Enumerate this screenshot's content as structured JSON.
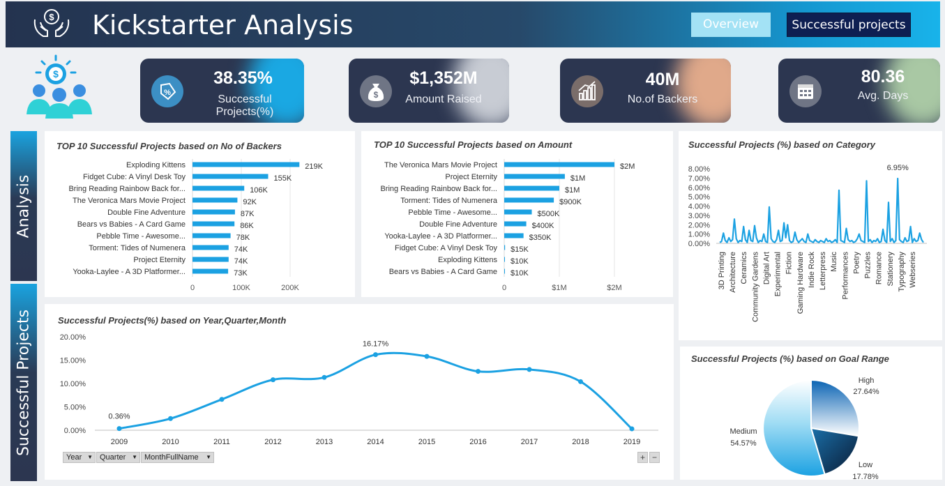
{
  "header": {
    "title": "Kickstarter Analysis",
    "nav_overview": "Overview",
    "nav_successful": "Successful projects"
  },
  "kpis": [
    {
      "value": "38.35%",
      "label": "Successful Projects(%)",
      "icon": "price-tag-percent-icon"
    },
    {
      "value": "$1,352M",
      "label": "Amount Raised",
      "icon": "money-bag-icon"
    },
    {
      "value": "40M",
      "label": "No.of Backers",
      "icon": "bar-chart-icon"
    },
    {
      "value": "80.36",
      "label": "Avg. Days",
      "icon": "calendar-icon"
    }
  ],
  "side_tabs": {
    "analysis": "Analysis",
    "successful": "Successful Projects"
  },
  "slicers": {
    "year": "Year",
    "quarter": "Quarter",
    "month": "MonthFullName",
    "plus": "+",
    "minus": "−"
  },
  "colors": {
    "accent": "#1ba1e2",
    "dark": "#2c3650",
    "header_start": "#24334f"
  },
  "chart_data": [
    {
      "id": "backers",
      "type": "bar",
      "title": "TOP 10 Successful Projects based on No of Backers",
      "categories": [
        "Exploding Kittens",
        "Fidget Cube: A Vinyl Desk Toy",
        "Bring Reading Rainbow Back for...",
        "The Veronica Mars Movie Project",
        "Double Fine Adventure",
        "Bears vs Babies - A Card Game",
        "Pebble Time - Awesome...",
        "Torment: Tides of Numenera",
        "Project Eternity",
        "Yooka-Laylee - A 3D Platformer..."
      ],
      "values": [
        219000,
        155000,
        106000,
        92000,
        87000,
        86000,
        78000,
        74000,
        74000,
        73000
      ],
      "data_labels": [
        "219K",
        "155K",
        "106K",
        "92K",
        "87K",
        "86K",
        "78K",
        "74K",
        "74K",
        "73K"
      ],
      "x_ticks": [
        "0",
        "100K",
        "200K"
      ],
      "xlim": [
        0,
        200000
      ]
    },
    {
      "id": "amount",
      "type": "bar",
      "title": "TOP 10 Successful Projects based on Amount",
      "categories": [
        "The Veronica Mars Movie Project",
        "Project Eternity",
        "Bring Reading Rainbow Back for...",
        "Torment: Tides of Numenera",
        "Pebble Time - Awesome...",
        "Double Fine Adventure",
        "Yooka-Laylee - A 3D Platformer...",
        "Fidget Cube: A Vinyl Desk Toy",
        "Exploding Kittens",
        "Bears vs Babies - A Card Game"
      ],
      "values": [
        2000000,
        1100000,
        1000000,
        900000,
        500000,
        400000,
        350000,
        15000,
        10000,
        10000
      ],
      "data_labels": [
        "$2M",
        "$1M",
        "$1M",
        "$900K",
        "$500K",
        "$400K",
        "$350K",
        "$15K",
        "$10K",
        "$10K"
      ],
      "x_ticks": [
        "0",
        "$1M",
        "$2M"
      ],
      "xlim": [
        0,
        2000000
      ]
    },
    {
      "id": "category",
      "type": "line",
      "title": "Successful Projects (%) based on Category",
      "y_ticks": [
        "8.00%",
        "7.00%",
        "6.00%",
        "5.00%",
        "4.00%",
        "3.00%",
        "2.00%",
        "1.00%",
        "0.00%"
      ],
      "ylim": [
        0,
        8
      ],
      "x_labels": [
        "3D Printing",
        "Architecture",
        "Ceramics",
        "Community Gardens",
        "Digital Art",
        "Experimental",
        "Fiction",
        "Gaming Hardware",
        "Indie Rock",
        "Letterpress",
        "Music",
        "Performances",
        "Poetry",
        "Puzzles",
        "Romance",
        "Stationery",
        "Typography",
        "Webseries"
      ],
      "annotation": "6.95%",
      "values": [
        0.1,
        0.2,
        1.1,
        0.3,
        0.1,
        0.6,
        0.2,
        0.4,
        2.6,
        0.5,
        0.1,
        0.3,
        0.2,
        1.8,
        0.4,
        0.1,
        1.4,
        0.3,
        0.2,
        1.9,
        0.6,
        0.1,
        0.3,
        0.2,
        1.0,
        0.2,
        0.1,
        3.9,
        0.5,
        0.2,
        0.1,
        0.4,
        1.4,
        0.2,
        0.3,
        2.2,
        0.6,
        2.0,
        0.3,
        0.1,
        0.2,
        1.2,
        0.4,
        0.1,
        0.3,
        0.5,
        0.2,
        0.1,
        1.0,
        0.3,
        0.2,
        0.1,
        0.4,
        0.2,
        0.1,
        0.3,
        0.2,
        0.1,
        0.5,
        0.2,
        0.3,
        0.1,
        0.2,
        0.4,
        0.1,
        5.7,
        0.3,
        0.2,
        0.1,
        1.6,
        0.4,
        0.2,
        0.3,
        0.1,
        0.2,
        0.5,
        1.0,
        0.3,
        0.2,
        0.1,
        6.7,
        0.2,
        0.4,
        0.1,
        0.3,
        0.2,
        0.5,
        0.1,
        0.2,
        1.5,
        0.3,
        0.1,
        4.4,
        0.2,
        0.5,
        0.1,
        0.3,
        6.95,
        0.4,
        0.2,
        0.1,
        0.6,
        0.2,
        0.3,
        1.8,
        0.1,
        0.5,
        0.2,
        0.3,
        1.1,
        0.4,
        0.1
      ]
    },
    {
      "id": "yearly",
      "type": "line",
      "title": "Successful Projects(%) based on Year,Quarter,Month",
      "categories": [
        "2009",
        "2010",
        "2011",
        "2012",
        "2013",
        "2014",
        "2015",
        "2016",
        "2017",
        "2018",
        "2019"
      ],
      "values": [
        0.36,
        2.5,
        6.6,
        10.8,
        11.3,
        16.17,
        15.8,
        12.6,
        13.0,
        10.4,
        0.3
      ],
      "y_ticks": [
        "20.00%",
        "15.00%",
        "10.00%",
        "5.00%",
        "0.00%"
      ],
      "ylim": [
        0,
        20
      ],
      "annotations": [
        "0.36%",
        "16.17%"
      ]
    },
    {
      "id": "goal",
      "type": "pie",
      "title": "Successful Projects (%) based on Goal Range",
      "slices": [
        {
          "name": "High",
          "value": 27.64,
          "label": "27.64%"
        },
        {
          "name": "Low",
          "value": 17.78,
          "label": "17.78%"
        },
        {
          "name": "Medium",
          "value": 54.57,
          "label": "54.57%"
        }
      ]
    }
  ]
}
